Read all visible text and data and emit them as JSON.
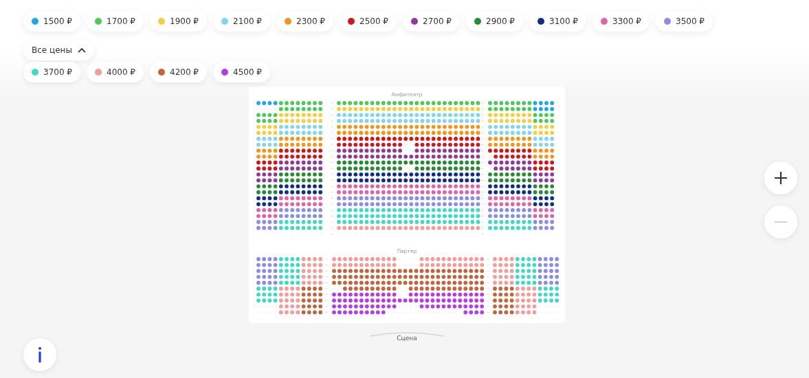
{
  "price_filters": [
    {
      "label": "1500 ₽",
      "color": "#1ea7e8"
    },
    {
      "label": "1700 ₽",
      "color": "#4cc95a"
    },
    {
      "label": "1900 ₽",
      "color": "#f6cd3c"
    },
    {
      "label": "2100 ₽",
      "color": "#7fd6ee"
    },
    {
      "label": "2300 ₽",
      "color": "#f0961c"
    },
    {
      "label": "2500 ₽",
      "color": "#d0161c"
    },
    {
      "label": "2700 ₽",
      "color": "#8e3a9c"
    },
    {
      "label": "2900 ₽",
      "color": "#278a34"
    },
    {
      "label": "3100 ₽",
      "color": "#0f2f86"
    },
    {
      "label": "3300 ₽",
      "color": "#e063a6"
    },
    {
      "label": "3500 ₽",
      "color": "#8d8ce3"
    }
  ],
  "all_prices_toggle": {
    "label": "Все цены",
    "expanded": true
  },
  "more_price_filters": [
    {
      "label": "3700 ₽",
      "color": "#40d9c4"
    },
    {
      "label": "4000 ₽",
      "color": "#f29c9c"
    },
    {
      "label": "4200 ₽",
      "color": "#c0663c"
    },
    {
      "label": "4500 ₽",
      "color": "#b43fe0"
    }
  ],
  "seat_map": {
    "sections": [
      {
        "title": "Амфитеатр"
      },
      {
        "title": "Партер"
      }
    ],
    "stage_label": "Сцена"
  },
  "zoom_in": {
    "disabled": false
  },
  "zoom_out": {
    "disabled": true
  }
}
